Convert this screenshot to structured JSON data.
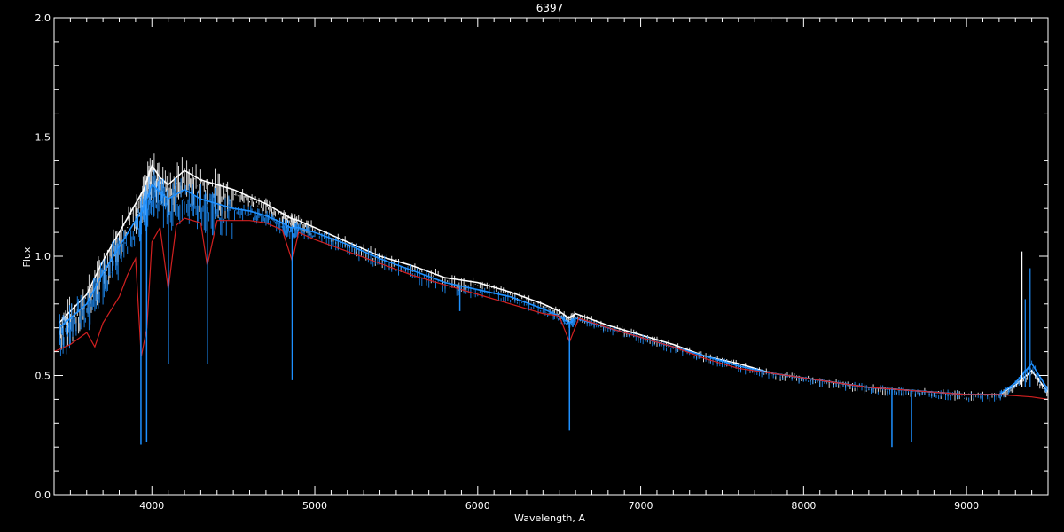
{
  "colors": {
    "background": "#000000",
    "axes": "#ffffff",
    "observed_white": "#ffffff",
    "observed_blue": "#1e90ff",
    "model_red": "#d22020"
  },
  "chart_data": {
    "type": "line",
    "title": "6397",
    "xlabel": "Wavelength, A",
    "ylabel": "Flux",
    "xlim": [
      3400,
      9500
    ],
    "ylim": [
      0.0,
      2.0
    ],
    "xticks": [
      4000,
      5000,
      6000,
      7000,
      8000,
      9000
    ],
    "xtick_labels": [
      "4000",
      "5000",
      "6000",
      "7000",
      "8000",
      "9000"
    ],
    "yticks": [
      0.0,
      0.5,
      1.0,
      1.5,
      2.0
    ],
    "ytick_labels": [
      "0.0",
      "0.5",
      "1.0",
      "1.5",
      "2.0"
    ],
    "grid": false,
    "series": [
      {
        "key": "observed_white",
        "x": [
          3430,
          3500,
          3600,
          3700,
          3800,
          3900,
          3950,
          4000,
          4050,
          4100,
          4200,
          4300,
          4400,
          4500,
          4600,
          4700,
          4800,
          4850,
          4900,
          5000,
          5200,
          5400,
          5600,
          5800,
          6000,
          6200,
          6400,
          6500,
          6560,
          6600,
          6800,
          7000,
          7200,
          7400,
          7600,
          7800,
          8000,
          8200,
          8400,
          8600,
          8800,
          9000,
          9200,
          9300,
          9400,
          9500
        ],
        "y": [
          0.72,
          0.77,
          0.84,
          0.98,
          1.1,
          1.22,
          1.28,
          1.38,
          1.33,
          1.3,
          1.36,
          1.32,
          1.3,
          1.28,
          1.25,
          1.22,
          1.18,
          1.16,
          1.15,
          1.12,
          1.06,
          1.0,
          0.96,
          0.91,
          0.89,
          0.85,
          0.8,
          0.77,
          0.74,
          0.76,
          0.71,
          0.67,
          0.63,
          0.58,
          0.55,
          0.51,
          0.49,
          0.47,
          0.45,
          0.44,
          0.43,
          0.42,
          0.42,
          0.46,
          0.52,
          0.43
        ]
      },
      {
        "key": "observed_blue",
        "x": [
          3430,
          3500,
          3600,
          3700,
          3800,
          3900,
          3950,
          4000,
          4050,
          4100,
          4200,
          4300,
          4400,
          4500,
          4600,
          4700,
          4800,
          4850,
          4900,
          5000,
          5200,
          5400,
          5600,
          5800,
          6000,
          6200,
          6400,
          6500,
          6560,
          6600,
          6800,
          7000,
          7200,
          7400,
          7600,
          7800,
          8000,
          8200,
          8400,
          8600,
          8800,
          9000,
          9200,
          9300,
          9400,
          9500
        ],
        "y": [
          0.7,
          0.74,
          0.8,
          0.93,
          1.04,
          1.15,
          1.2,
          1.3,
          1.27,
          1.24,
          1.28,
          1.24,
          1.22,
          1.2,
          1.19,
          1.17,
          1.14,
          1.12,
          1.12,
          1.1,
          1.05,
          0.99,
          0.94,
          0.89,
          0.86,
          0.83,
          0.78,
          0.75,
          0.72,
          0.74,
          0.7,
          0.66,
          0.62,
          0.58,
          0.54,
          0.51,
          0.49,
          0.47,
          0.45,
          0.44,
          0.43,
          0.42,
          0.42,
          0.47,
          0.55,
          0.44
        ]
      },
      {
        "key": "model_red",
        "x": [
          3400,
          3500,
          3600,
          3650,
          3700,
          3800,
          3850,
          3900,
          3935,
          3970,
          4000,
          4050,
          4101,
          4150,
          4200,
          4300,
          4340,
          4400,
          4500,
          4600,
          4700,
          4800,
          4861,
          4900,
          5000,
          5200,
          5400,
          5600,
          5800,
          6000,
          6200,
          6400,
          6500,
          6563,
          6620,
          6800,
          7000,
          7200,
          7400,
          7600,
          7800,
          8000,
          8200,
          8400,
          8600,
          8800,
          9000,
          9200,
          9400,
          9500
        ],
        "y": [
          0.6,
          0.63,
          0.68,
          0.62,
          0.72,
          0.83,
          0.92,
          0.99,
          0.58,
          0.7,
          1.06,
          1.12,
          0.86,
          1.13,
          1.16,
          1.14,
          0.96,
          1.15,
          1.15,
          1.15,
          1.14,
          1.11,
          0.98,
          1.1,
          1.07,
          1.02,
          0.97,
          0.92,
          0.88,
          0.84,
          0.8,
          0.76,
          0.75,
          0.64,
          0.74,
          0.7,
          0.66,
          0.62,
          0.57,
          0.53,
          0.51,
          0.49,
          0.47,
          0.45,
          0.44,
          0.43,
          0.42,
          0.42,
          0.41,
          0.4
        ]
      }
    ],
    "absorption_lines": {
      "x": [
        3933,
        3968,
        4101,
        4340,
        4861,
        5890,
        6563,
        8542,
        8662
      ],
      "depth_to": [
        0.21,
        0.22,
        0.55,
        0.55,
        0.48,
        0.77,
        0.27,
        0.2,
        0.22
      ]
    },
    "peak": {
      "x": [
        9340,
        9360,
        9390
      ],
      "y": [
        1.02,
        0.82,
        0.95
      ]
    }
  }
}
